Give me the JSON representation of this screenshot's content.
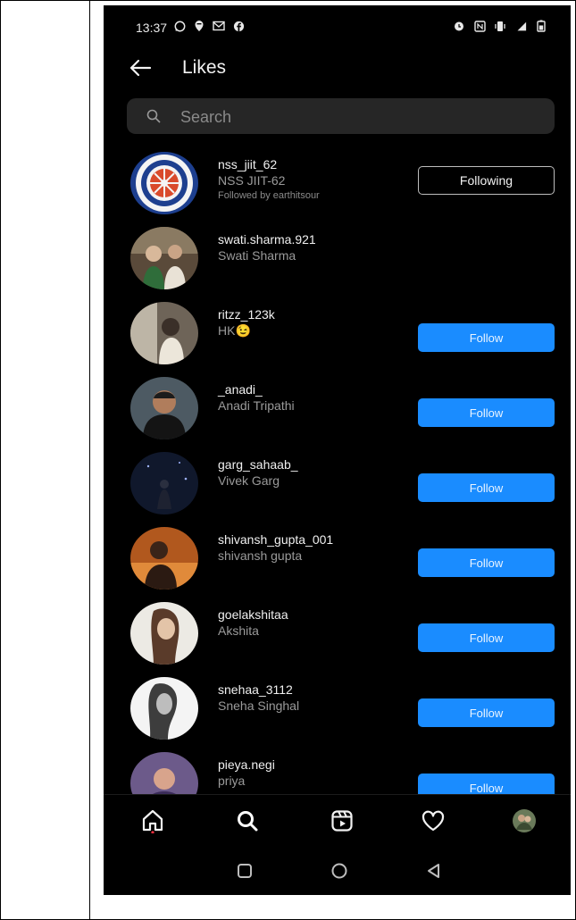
{
  "status_bar": {
    "time": "13:37",
    "left_icons": [
      "whatsapp-icon",
      "location-icon",
      "gmail-icon",
      "facebook-icon"
    ],
    "right_icons": [
      "alarm-icon",
      "nfc-icon",
      "vibrate-icon",
      "signal-icon",
      "battery-icon"
    ]
  },
  "header": {
    "title": "Likes",
    "back_icon": "arrow-left-icon"
  },
  "search": {
    "placeholder": "Search",
    "icon": "search-icon"
  },
  "likes": [
    {
      "username": "nss_jiit_62",
      "full_name": "NSS JIIT-62",
      "followed_by": "Followed by earthitsour",
      "button": "Following",
      "button_style": "outline"
    },
    {
      "username": "swati.sharma.921",
      "full_name": "Swati Sharma",
      "button": "",
      "button_style": "none"
    },
    {
      "username": "ritzz_123k",
      "full_name": "HK",
      "emoji": "😉",
      "button": "Follow",
      "button_style": "primary"
    },
    {
      "username": "_anadi_",
      "full_name": "Anadi Tripathi",
      "button": "Follow",
      "button_style": "primary"
    },
    {
      "username": "garg_sahaab_",
      "full_name": "Vivek Garg",
      "button": "Follow",
      "button_style": "primary"
    },
    {
      "username": "shivansh_gupta_001",
      "full_name": "shivansh gupta",
      "button": "Follow",
      "button_style": "primary"
    },
    {
      "username": "goelakshitaa",
      "full_name": "Akshita",
      "button": "Follow",
      "button_style": "primary"
    },
    {
      "username": "snehaa_3112",
      "full_name": "Sneha Singhal",
      "button": "Follow",
      "button_style": "primary"
    },
    {
      "username": "pieya.negi",
      "full_name": "priya",
      "button": "Follow",
      "button_style": "primary"
    }
  ],
  "bottom_nav": [
    "home-icon",
    "search-icon",
    "reels-icon",
    "heart-icon",
    "profile-avatar"
  ],
  "system_nav": [
    "recents-icon",
    "home-circle-icon",
    "back-triangle-icon"
  ],
  "colors": {
    "background": "#000000",
    "search_bg": "#262626",
    "follow_button": "#1a8cff",
    "secondary_text": "#9a9a9a"
  }
}
